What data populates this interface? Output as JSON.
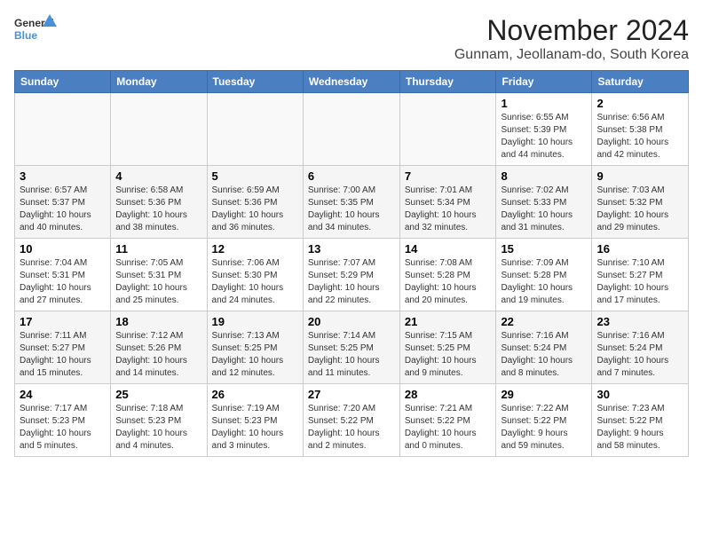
{
  "logo": {
    "line1": "General",
    "line2": "Blue"
  },
  "title": "November 2024",
  "subtitle": "Gunnam, Jeollanam-do, South Korea",
  "weekdays": [
    "Sunday",
    "Monday",
    "Tuesday",
    "Wednesday",
    "Thursday",
    "Friday",
    "Saturday"
  ],
  "weeks": [
    [
      {
        "day": "",
        "info": ""
      },
      {
        "day": "",
        "info": ""
      },
      {
        "day": "",
        "info": ""
      },
      {
        "day": "",
        "info": ""
      },
      {
        "day": "",
        "info": ""
      },
      {
        "day": "1",
        "info": "Sunrise: 6:55 AM\nSunset: 5:39 PM\nDaylight: 10 hours\nand 44 minutes."
      },
      {
        "day": "2",
        "info": "Sunrise: 6:56 AM\nSunset: 5:38 PM\nDaylight: 10 hours\nand 42 minutes."
      }
    ],
    [
      {
        "day": "3",
        "info": "Sunrise: 6:57 AM\nSunset: 5:37 PM\nDaylight: 10 hours\nand 40 minutes."
      },
      {
        "day": "4",
        "info": "Sunrise: 6:58 AM\nSunset: 5:36 PM\nDaylight: 10 hours\nand 38 minutes."
      },
      {
        "day": "5",
        "info": "Sunrise: 6:59 AM\nSunset: 5:36 PM\nDaylight: 10 hours\nand 36 minutes."
      },
      {
        "day": "6",
        "info": "Sunrise: 7:00 AM\nSunset: 5:35 PM\nDaylight: 10 hours\nand 34 minutes."
      },
      {
        "day": "7",
        "info": "Sunrise: 7:01 AM\nSunset: 5:34 PM\nDaylight: 10 hours\nand 32 minutes."
      },
      {
        "day": "8",
        "info": "Sunrise: 7:02 AM\nSunset: 5:33 PM\nDaylight: 10 hours\nand 31 minutes."
      },
      {
        "day": "9",
        "info": "Sunrise: 7:03 AM\nSunset: 5:32 PM\nDaylight: 10 hours\nand 29 minutes."
      }
    ],
    [
      {
        "day": "10",
        "info": "Sunrise: 7:04 AM\nSunset: 5:31 PM\nDaylight: 10 hours\nand 27 minutes."
      },
      {
        "day": "11",
        "info": "Sunrise: 7:05 AM\nSunset: 5:31 PM\nDaylight: 10 hours\nand 25 minutes."
      },
      {
        "day": "12",
        "info": "Sunrise: 7:06 AM\nSunset: 5:30 PM\nDaylight: 10 hours\nand 24 minutes."
      },
      {
        "day": "13",
        "info": "Sunrise: 7:07 AM\nSunset: 5:29 PM\nDaylight: 10 hours\nand 22 minutes."
      },
      {
        "day": "14",
        "info": "Sunrise: 7:08 AM\nSunset: 5:28 PM\nDaylight: 10 hours\nand 20 minutes."
      },
      {
        "day": "15",
        "info": "Sunrise: 7:09 AM\nSunset: 5:28 PM\nDaylight: 10 hours\nand 19 minutes."
      },
      {
        "day": "16",
        "info": "Sunrise: 7:10 AM\nSunset: 5:27 PM\nDaylight: 10 hours\nand 17 minutes."
      }
    ],
    [
      {
        "day": "17",
        "info": "Sunrise: 7:11 AM\nSunset: 5:27 PM\nDaylight: 10 hours\nand 15 minutes."
      },
      {
        "day": "18",
        "info": "Sunrise: 7:12 AM\nSunset: 5:26 PM\nDaylight: 10 hours\nand 14 minutes."
      },
      {
        "day": "19",
        "info": "Sunrise: 7:13 AM\nSunset: 5:25 PM\nDaylight: 10 hours\nand 12 minutes."
      },
      {
        "day": "20",
        "info": "Sunrise: 7:14 AM\nSunset: 5:25 PM\nDaylight: 10 hours\nand 11 minutes."
      },
      {
        "day": "21",
        "info": "Sunrise: 7:15 AM\nSunset: 5:25 PM\nDaylight: 10 hours\nand 9 minutes."
      },
      {
        "day": "22",
        "info": "Sunrise: 7:16 AM\nSunset: 5:24 PM\nDaylight: 10 hours\nand 8 minutes."
      },
      {
        "day": "23",
        "info": "Sunrise: 7:16 AM\nSunset: 5:24 PM\nDaylight: 10 hours\nand 7 minutes."
      }
    ],
    [
      {
        "day": "24",
        "info": "Sunrise: 7:17 AM\nSunset: 5:23 PM\nDaylight: 10 hours\nand 5 minutes."
      },
      {
        "day": "25",
        "info": "Sunrise: 7:18 AM\nSunset: 5:23 PM\nDaylight: 10 hours\nand 4 minutes."
      },
      {
        "day": "26",
        "info": "Sunrise: 7:19 AM\nSunset: 5:23 PM\nDaylight: 10 hours\nand 3 minutes."
      },
      {
        "day": "27",
        "info": "Sunrise: 7:20 AM\nSunset: 5:22 PM\nDaylight: 10 hours\nand 2 minutes."
      },
      {
        "day": "28",
        "info": "Sunrise: 7:21 AM\nSunset: 5:22 PM\nDaylight: 10 hours\nand 0 minutes."
      },
      {
        "day": "29",
        "info": "Sunrise: 7:22 AM\nSunset: 5:22 PM\nDaylight: 9 hours\nand 59 minutes."
      },
      {
        "day": "30",
        "info": "Sunrise: 7:23 AM\nSunset: 5:22 PM\nDaylight: 9 hours\nand 58 minutes."
      }
    ]
  ]
}
